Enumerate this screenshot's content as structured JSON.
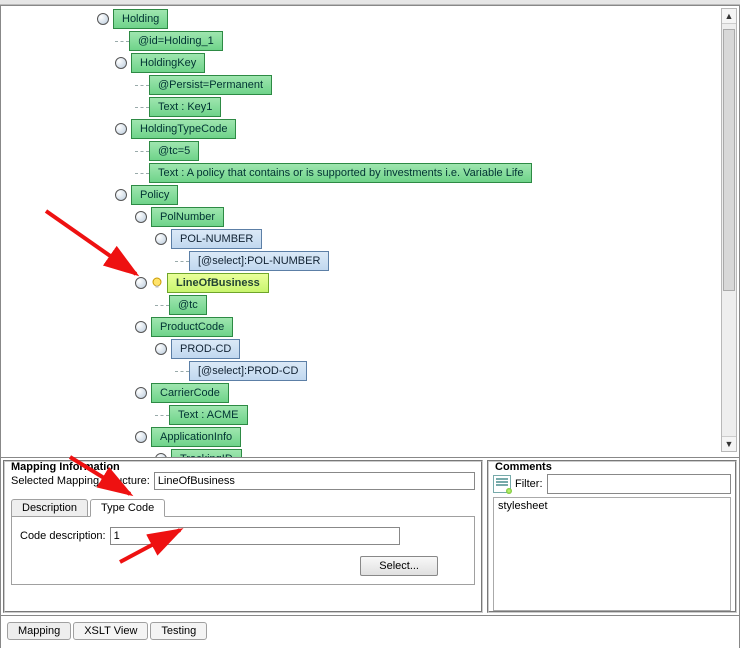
{
  "tree": {
    "holding": "Holding",
    "id_holding": "@id=Holding_1",
    "holding_key": "HoldingKey",
    "persist": "@Persist=Permanent",
    "text_key1": "Text : Key1",
    "holding_type_code": "HoldingTypeCode",
    "tc5": "@tc=5",
    "text_policy": "Text : A policy that contains or is supported by investments i.e. Variable Life",
    "policy": "Policy",
    "pol_number": "PolNumber",
    "pol_number_blue": "POL-NUMBER",
    "select_pol_number": "[@select]:POL-NUMBER",
    "line_of_business": "LineOfBusiness",
    "at_tc": "@tc",
    "product_code": "ProductCode",
    "prod_cd": "PROD-CD",
    "select_prod_cd": "[@select]:PROD-CD",
    "carrier_code": "CarrierCode",
    "text_acme": "Text : ACME",
    "application_info": "ApplicationInfo",
    "tracking_id": "TrackingID"
  },
  "mapping_info": {
    "title": "Mapping Information",
    "selected_label": "Selected Mapping Structure:",
    "selected_value": "LineOfBusiness",
    "tabs": {
      "description": "Description",
      "type_code": "Type Code"
    },
    "code_desc_label": "Code description:",
    "code_desc_value": "1",
    "select_btn": "Select..."
  },
  "comments": {
    "title": "Comments",
    "filter_label": "Filter:",
    "filter_value": "",
    "item1": "stylesheet"
  },
  "footer": {
    "mapping": "Mapping",
    "xslt": "XSLT View",
    "testing": "Testing"
  }
}
